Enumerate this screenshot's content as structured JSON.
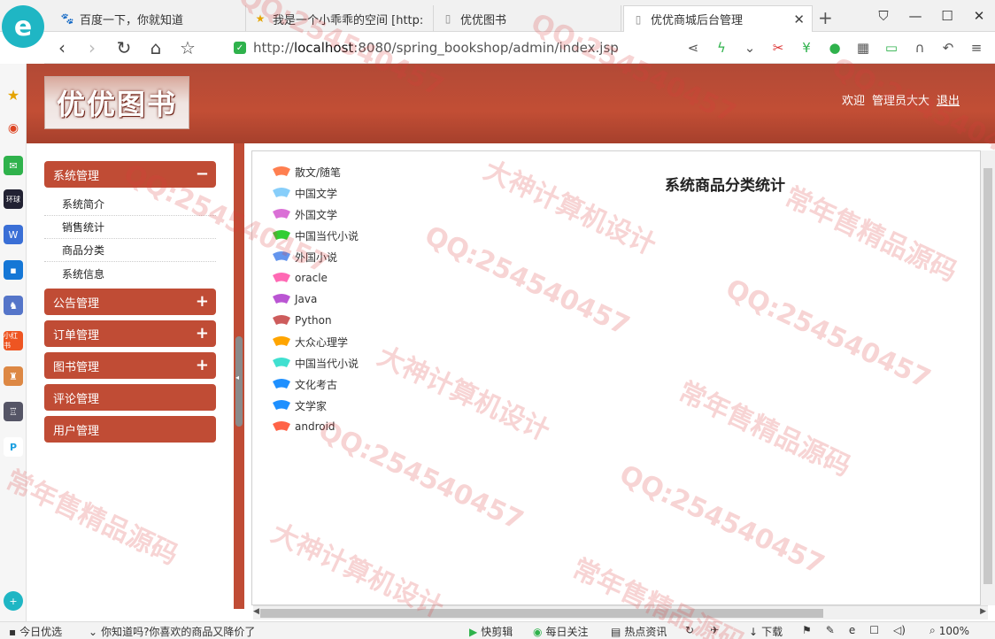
{
  "browser": {
    "tabs": [
      {
        "label": "百度一下，你就知道"
      },
      {
        "label": "我是一个小乖乖的空间 [http:"
      },
      {
        "label": "优优图书"
      },
      {
        "label": "优优商城后台管理"
      }
    ],
    "new_tab": "+",
    "address": {
      "prefix": "http://",
      "host": "localhost",
      "rest": ":8080/spring_bookshop/admin/index.jsp"
    }
  },
  "header": {
    "logo_text": "优优图书",
    "welcome": "欢迎",
    "username": "管理员大大",
    "logout": "退出"
  },
  "sidebar": {
    "groups": [
      {
        "label": "系统管理",
        "toggle": "−"
      },
      {
        "label": "公告管理",
        "toggle": "+"
      },
      {
        "label": "订单管理",
        "toggle": "+"
      },
      {
        "label": "图书管理",
        "toggle": "+"
      },
      {
        "label": "评论管理"
      },
      {
        "label": "用户管理"
      }
    ],
    "sub_items": [
      "系统简介",
      "销售统计",
      "商品分类",
      "系统信息"
    ]
  },
  "chart_data": {
    "type": "pie",
    "title": "系统商品分类统计",
    "legend_placement": "top-left",
    "categories": [
      "散文/随笔",
      "中国文学",
      "外国文学",
      "中国当代小说",
      "外国小说",
      "oracle",
      "Java",
      "Python",
      "大众心理学",
      "中国当代小说",
      "文化考古",
      "文学家",
      "android"
    ],
    "colors": [
      "#ff7f50",
      "#87cefa",
      "#da70d6",
      "#32cd32",
      "#6495ed",
      "#ff69b4",
      "#ba55d3",
      "#cd5c5c",
      "#ffa500",
      "#40e0d0",
      "#1e90ff",
      "#1e90ff",
      "#ff6347"
    ],
    "values": []
  },
  "statusbar": {
    "left": "今日优选",
    "news": "你知道吗?你喜欢的商品又降价了",
    "kuaijianji": "快剪辑",
    "meiriguanzhu": "每日关注",
    "redian": "热点资讯",
    "download": "下载",
    "zoom": "100%"
  },
  "watermark": {
    "qq": "QQ:254540457",
    "text1": "大神计算机设计",
    "text2": "常年售精品源码"
  }
}
